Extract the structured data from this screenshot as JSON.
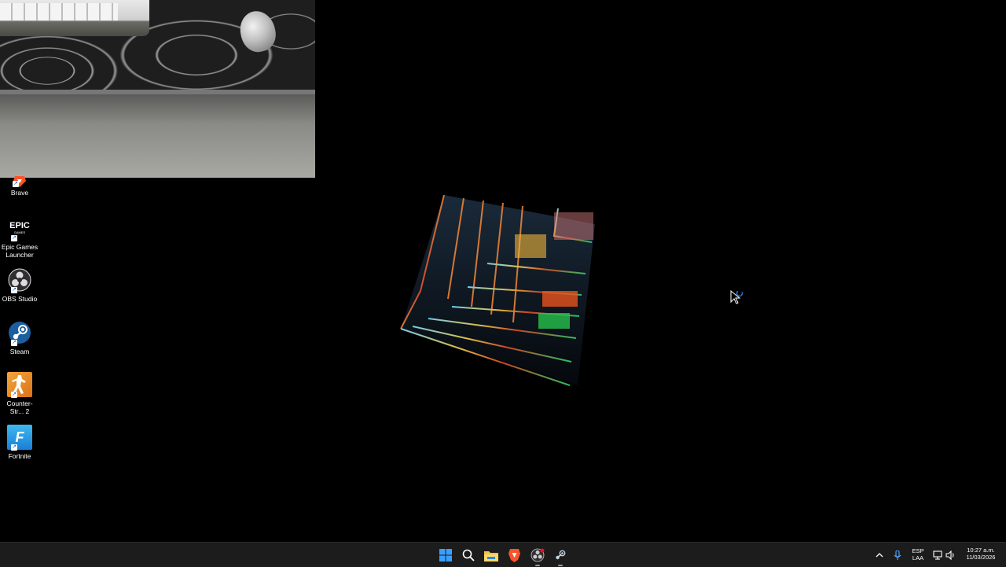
{
  "desktop": {
    "icons": [
      {
        "label": "Brave",
        "icon": "brave-icon"
      },
      {
        "label": "Epic Games Launcher",
        "icon": "epic-games-icon",
        "logo_text": "EPIC",
        "logo_sub": "GAMES"
      },
      {
        "label": "OBS Studio",
        "icon": "obs-icon"
      },
      {
        "label": "Steam",
        "icon": "steam-icon"
      },
      {
        "label": "Counter-Str... 2",
        "icon": "counter-strike-icon"
      },
      {
        "label": "Fortnite",
        "icon": "fortnite-icon",
        "logo_text": "F"
      }
    ],
    "webcam_overlay": {
      "description_icon": "webcam-feed"
    },
    "wallpaper": {
      "icon": "glass-cube-wallpaper"
    }
  },
  "taskbar": {
    "apps": [
      {
        "name": "start",
        "icon": "windows-start-icon"
      },
      {
        "name": "search",
        "icon": "search-icon"
      },
      {
        "name": "file-explorer",
        "icon": "folder-icon"
      },
      {
        "name": "brave",
        "icon": "brave-icon"
      },
      {
        "name": "obs",
        "icon": "obs-icon",
        "notification": true
      },
      {
        "name": "steam",
        "icon": "steam-icon"
      }
    ],
    "tray": {
      "language_top": "ESP",
      "language_bottom": "LAA",
      "time": "10:27 a.m.",
      "date": "11/03/2026"
    }
  },
  "colors": {
    "taskbar_bg": "#1c1c1c",
    "start_blue": "#3aa0ff",
    "brave_orange": "#fb542b",
    "steam_blue": "#1b5f9e",
    "folder_yellow": "#f3c24b"
  }
}
